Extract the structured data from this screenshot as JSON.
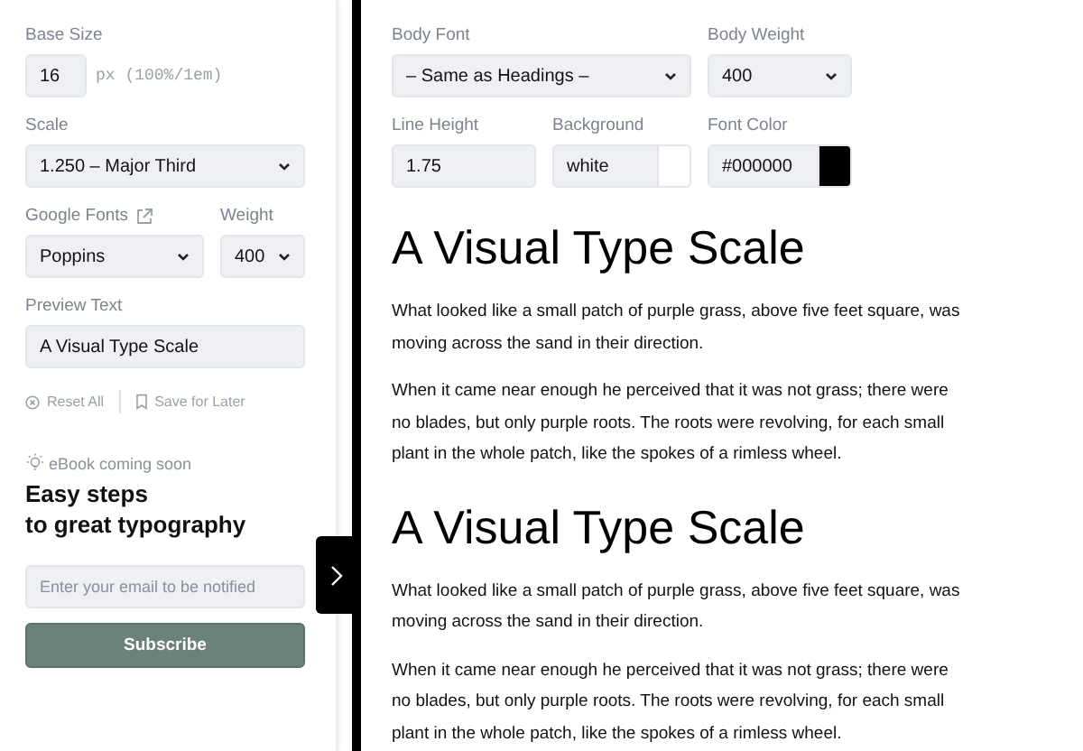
{
  "sidebar": {
    "base_size": {
      "label": "Base Size",
      "value": "16",
      "unit": "px (100%/1em)"
    },
    "scale": {
      "label": "Scale",
      "value": "1.250 – Major Third"
    },
    "google_fonts": {
      "label": "Google Fonts",
      "value": "Poppins"
    },
    "weight": {
      "label": "Weight",
      "value": "400"
    },
    "preview_text": {
      "label": "Preview Text",
      "value": "A Visual Type Scale"
    },
    "actions": [
      {
        "kind": "reset",
        "label": "Reset All"
      },
      {
        "kind": "save",
        "label": "Save for Later"
      }
    ],
    "ebook": {
      "badge": "eBook coming soon",
      "title_lines": [
        "Easy steps",
        "to great typography"
      ],
      "email_placeholder": "Enter your email to be notified",
      "button": "Subscribe"
    }
  },
  "settings": {
    "body_font": {
      "label": "Body Font",
      "value": "– Same as Headings –"
    },
    "body_weight": {
      "label": "Body Weight",
      "value": "400"
    },
    "line_height": {
      "label": "Line Height",
      "value": "1.75"
    },
    "background": {
      "label": "Background",
      "value": "white"
    },
    "font_color": {
      "label": "Font Color",
      "value": "#000000"
    }
  },
  "preview": [
    {
      "heading": "A Visual Type Scale",
      "paragraphs": [
        "What looked like a small patch of purple grass, above five feet square, was moving across the sand in their direction.",
        "When it came near enough he perceived that it was not grass; there were no blades, but only purple roots. The roots were revolving, for each small plant in the whole patch, like the spokes of a rimless wheel."
      ]
    },
    {
      "heading": "A Visual Type Scale",
      "paragraphs": [
        "What looked like a small patch of purple grass, above five feet square, was moving across the sand in their direction.",
        "When it came near enough he perceived that it was not grass; there were no blades, but only purple roots. The roots were revolving, for each small plant in the whole patch, like the spokes of a rimless wheel."
      ]
    }
  ]
}
